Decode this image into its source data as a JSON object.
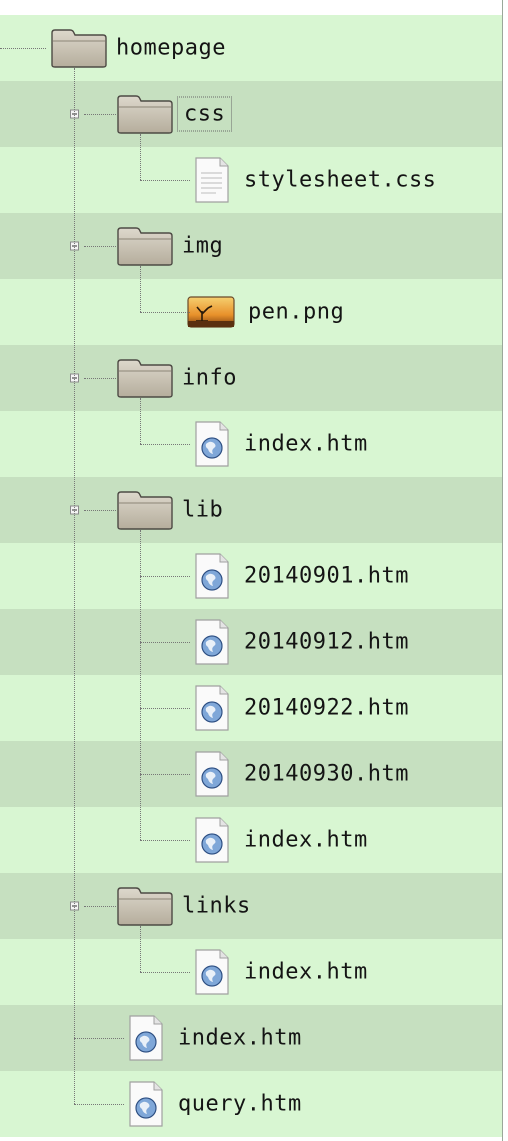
{
  "tree": {
    "nodes": [
      {
        "label": "homepage",
        "icon": "folder-icon",
        "depth": 0,
        "expander": false,
        "focused": false,
        "name": "tree-node-homepage"
      },
      {
        "label": "css",
        "icon": "folder-icon",
        "depth": 1,
        "expander": true,
        "focused": true,
        "name": "tree-node-css"
      },
      {
        "label": "stylesheet.css",
        "icon": "text-file-icon",
        "depth": 2,
        "expander": false,
        "focused": false,
        "name": "tree-node-stylesheet-css"
      },
      {
        "label": "img",
        "icon": "folder-icon",
        "depth": 1,
        "expander": true,
        "focused": false,
        "name": "tree-node-img"
      },
      {
        "label": "pen.png",
        "icon": "image-file-icon",
        "depth": 2,
        "expander": false,
        "focused": false,
        "name": "tree-node-pen-png"
      },
      {
        "label": "info",
        "icon": "folder-icon",
        "depth": 1,
        "expander": true,
        "focused": false,
        "name": "tree-node-info"
      },
      {
        "label": "index.htm",
        "icon": "html-file-icon",
        "depth": 2,
        "expander": false,
        "focused": false,
        "name": "tree-node-info-index-htm"
      },
      {
        "label": "lib",
        "icon": "folder-icon",
        "depth": 1,
        "expander": true,
        "focused": false,
        "name": "tree-node-lib"
      },
      {
        "label": "20140901.htm",
        "icon": "html-file-icon",
        "depth": 2,
        "expander": false,
        "focused": false,
        "name": "tree-node-20140901-htm"
      },
      {
        "label": "20140912.htm",
        "icon": "html-file-icon",
        "depth": 2,
        "expander": false,
        "focused": false,
        "name": "tree-node-20140912-htm"
      },
      {
        "label": "20140922.htm",
        "icon": "html-file-icon",
        "depth": 2,
        "expander": false,
        "focused": false,
        "name": "tree-node-20140922-htm"
      },
      {
        "label": "20140930.htm",
        "icon": "html-file-icon",
        "depth": 2,
        "expander": false,
        "focused": false,
        "name": "tree-node-20140930-htm"
      },
      {
        "label": "index.htm",
        "icon": "html-file-icon",
        "depth": 2,
        "expander": false,
        "focused": false,
        "name": "tree-node-lib-index-htm"
      },
      {
        "label": "links",
        "icon": "folder-icon",
        "depth": 1,
        "expander": true,
        "focused": false,
        "name": "tree-node-links"
      },
      {
        "label": "index.htm",
        "icon": "html-file-icon",
        "depth": 2,
        "expander": false,
        "focused": false,
        "name": "tree-node-links-index-htm"
      },
      {
        "label": "index.htm",
        "icon": "html-file-icon",
        "depth": 1,
        "expander": false,
        "focused": false,
        "name": "tree-node-index-htm"
      },
      {
        "label": "query.htm",
        "icon": "html-file-icon",
        "depth": 1,
        "expander": false,
        "focused": false,
        "name": "tree-node-query-htm"
      }
    ]
  },
  "colors": {
    "row_light": "#d8f6d2",
    "row_dark": "#c6e0c0",
    "connector": "#777777"
  }
}
